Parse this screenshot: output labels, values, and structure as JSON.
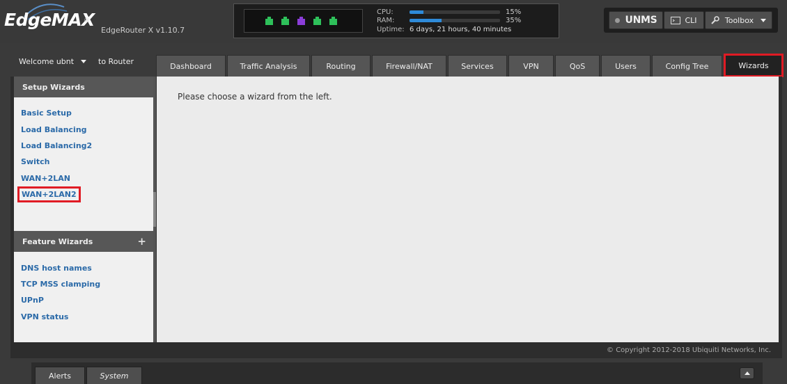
{
  "header": {
    "logo_text": "EdgeMAX",
    "logo_reg": "®",
    "device": "EdgeRouter X v1.10.7",
    "ports": [
      {
        "color": "#2ec05a"
      },
      {
        "color": "#2ec05a"
      },
      {
        "color": "#8b3dd8"
      },
      {
        "color": "#2ec05a"
      },
      {
        "color": "#2ec05a"
      }
    ],
    "cpu_label": "CPU:",
    "cpu_percent": 15,
    "cpu_text": "15%",
    "ram_label": "RAM:",
    "ram_percent": 35,
    "ram_text": "35%",
    "uptime_label": "Uptime:",
    "uptime_value": "6 days, 21 hours, 40 minutes",
    "unms_label": "UNMS",
    "cli_label": "CLI",
    "toolbox_label": "Toolbox"
  },
  "nav": {
    "welcome": "Welcome ubnt",
    "to_router": "to Router",
    "tabs": [
      "Dashboard",
      "Traffic Analysis",
      "Routing",
      "Firewall/NAT",
      "Services",
      "VPN",
      "QoS",
      "Users",
      "Config Tree",
      "Wizards"
    ],
    "active_tab": "Wizards"
  },
  "sidebar": {
    "setup_title": "Setup Wizards",
    "setup_items": [
      "Basic Setup",
      "Load Balancing",
      "Load Balancing2",
      "Switch",
      "WAN+2LAN",
      "WAN+2LAN2"
    ],
    "highlighted_item": "WAN+2LAN2",
    "feature_title": "Feature Wizards",
    "feature_plus": "+",
    "feature_items": [
      "DNS host names",
      "TCP MSS clamping",
      "UPnP",
      "VPN status"
    ]
  },
  "main": {
    "message": "Please choose a wizard from the left.",
    "copyright": "© Copyright 2012-2018 Ubiquiti Networks, Inc."
  },
  "footer": {
    "alerts_label": "Alerts",
    "system_label": "System"
  },
  "colors": {
    "highlight": "#e01b24",
    "link": "#2b6aa8",
    "bar": "#2e8ad8"
  }
}
